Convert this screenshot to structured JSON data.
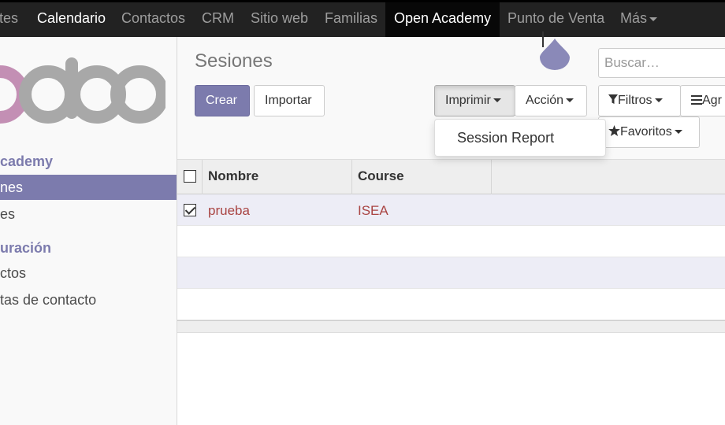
{
  "topbar": {
    "items": [
      {
        "label": "tes",
        "state": "normal"
      },
      {
        "label": "Calendario",
        "state": "light"
      },
      {
        "label": "Contactos",
        "state": "normal"
      },
      {
        "label": "CRM",
        "state": "normal"
      },
      {
        "label": "Sitio web",
        "state": "normal"
      },
      {
        "label": "Familias",
        "state": "normal"
      },
      {
        "label": "Open Academy",
        "state": "active"
      },
      {
        "label": "Punto de Venta",
        "state": "normal"
      }
    ],
    "more_label": "Más"
  },
  "sidebar": {
    "logo_text": "odoo",
    "section1": "cademy",
    "items": [
      "nes",
      "es"
    ],
    "section2": "uración",
    "items2": [
      "ctos",
      "tas de contacto"
    ]
  },
  "main": {
    "title": "Sesiones",
    "buttons": {
      "create": "Crear",
      "import": "Importar",
      "print": "Imprimir",
      "action": "Acción",
      "filters": "Filtros",
      "group": "Agr",
      "favorites": "Favoritos"
    },
    "search_placeholder": "Buscar…",
    "print_menu": [
      "Session Report"
    ]
  },
  "table": {
    "columns": [
      "Nombre",
      "Course"
    ],
    "rows": [
      {
        "selected": true,
        "cells": [
          "prueba",
          "ISEA"
        ]
      }
    ]
  },
  "colors": {
    "brand": "#7c7bad",
    "navbar": "#222222",
    "link_red": "#a94442"
  }
}
